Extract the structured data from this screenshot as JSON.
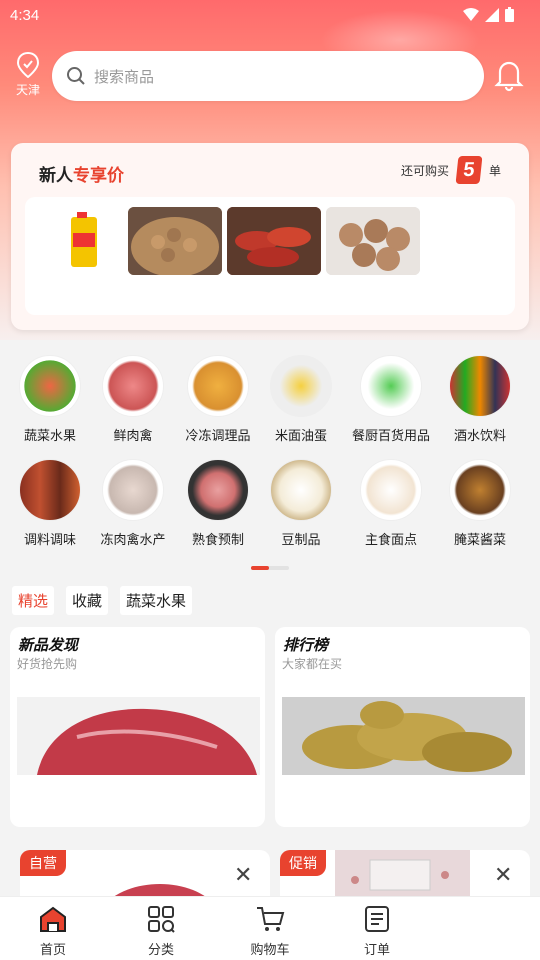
{
  "status": {
    "time": "4:34"
  },
  "location": "天津",
  "search": {
    "placeholder": "搜索商品"
  },
  "new_user": {
    "title_a": "新人",
    "title_b": "专享价",
    "remain_prefix": "还可购买",
    "remain_count": "5",
    "remain_suffix": "单"
  },
  "categories": [
    {
      "label": "蔬菜水果"
    },
    {
      "label": "鲜肉禽"
    },
    {
      "label": "冷冻调理品"
    },
    {
      "label": "米面油蛋"
    },
    {
      "label": "餐厨百货用品"
    },
    {
      "label": "酒水饮料"
    },
    {
      "label": "调料调味"
    },
    {
      "label": "冻肉禽水产"
    },
    {
      "label": "熟食预制"
    },
    {
      "label": "豆制品"
    },
    {
      "label": "主食面点"
    },
    {
      "label": "腌菜酱菜"
    }
  ],
  "filter_tabs": [
    {
      "label": "精选"
    },
    {
      "label": "收藏"
    },
    {
      "label": "蔬菜水果"
    }
  ],
  "featured": [
    {
      "title": "新品发现",
      "subtitle": "好货抢先购"
    },
    {
      "title": "排行榜",
      "subtitle": "大家都在买"
    }
  ],
  "product_badges": [
    "自营",
    "促销"
  ],
  "bottom_nav": [
    {
      "label": "首页"
    },
    {
      "label": "分类"
    },
    {
      "label": "购物车"
    },
    {
      "label": "订单"
    }
  ],
  "colors": {
    "accent": "#e8432f",
    "hero_top": "#ff6a6c"
  }
}
